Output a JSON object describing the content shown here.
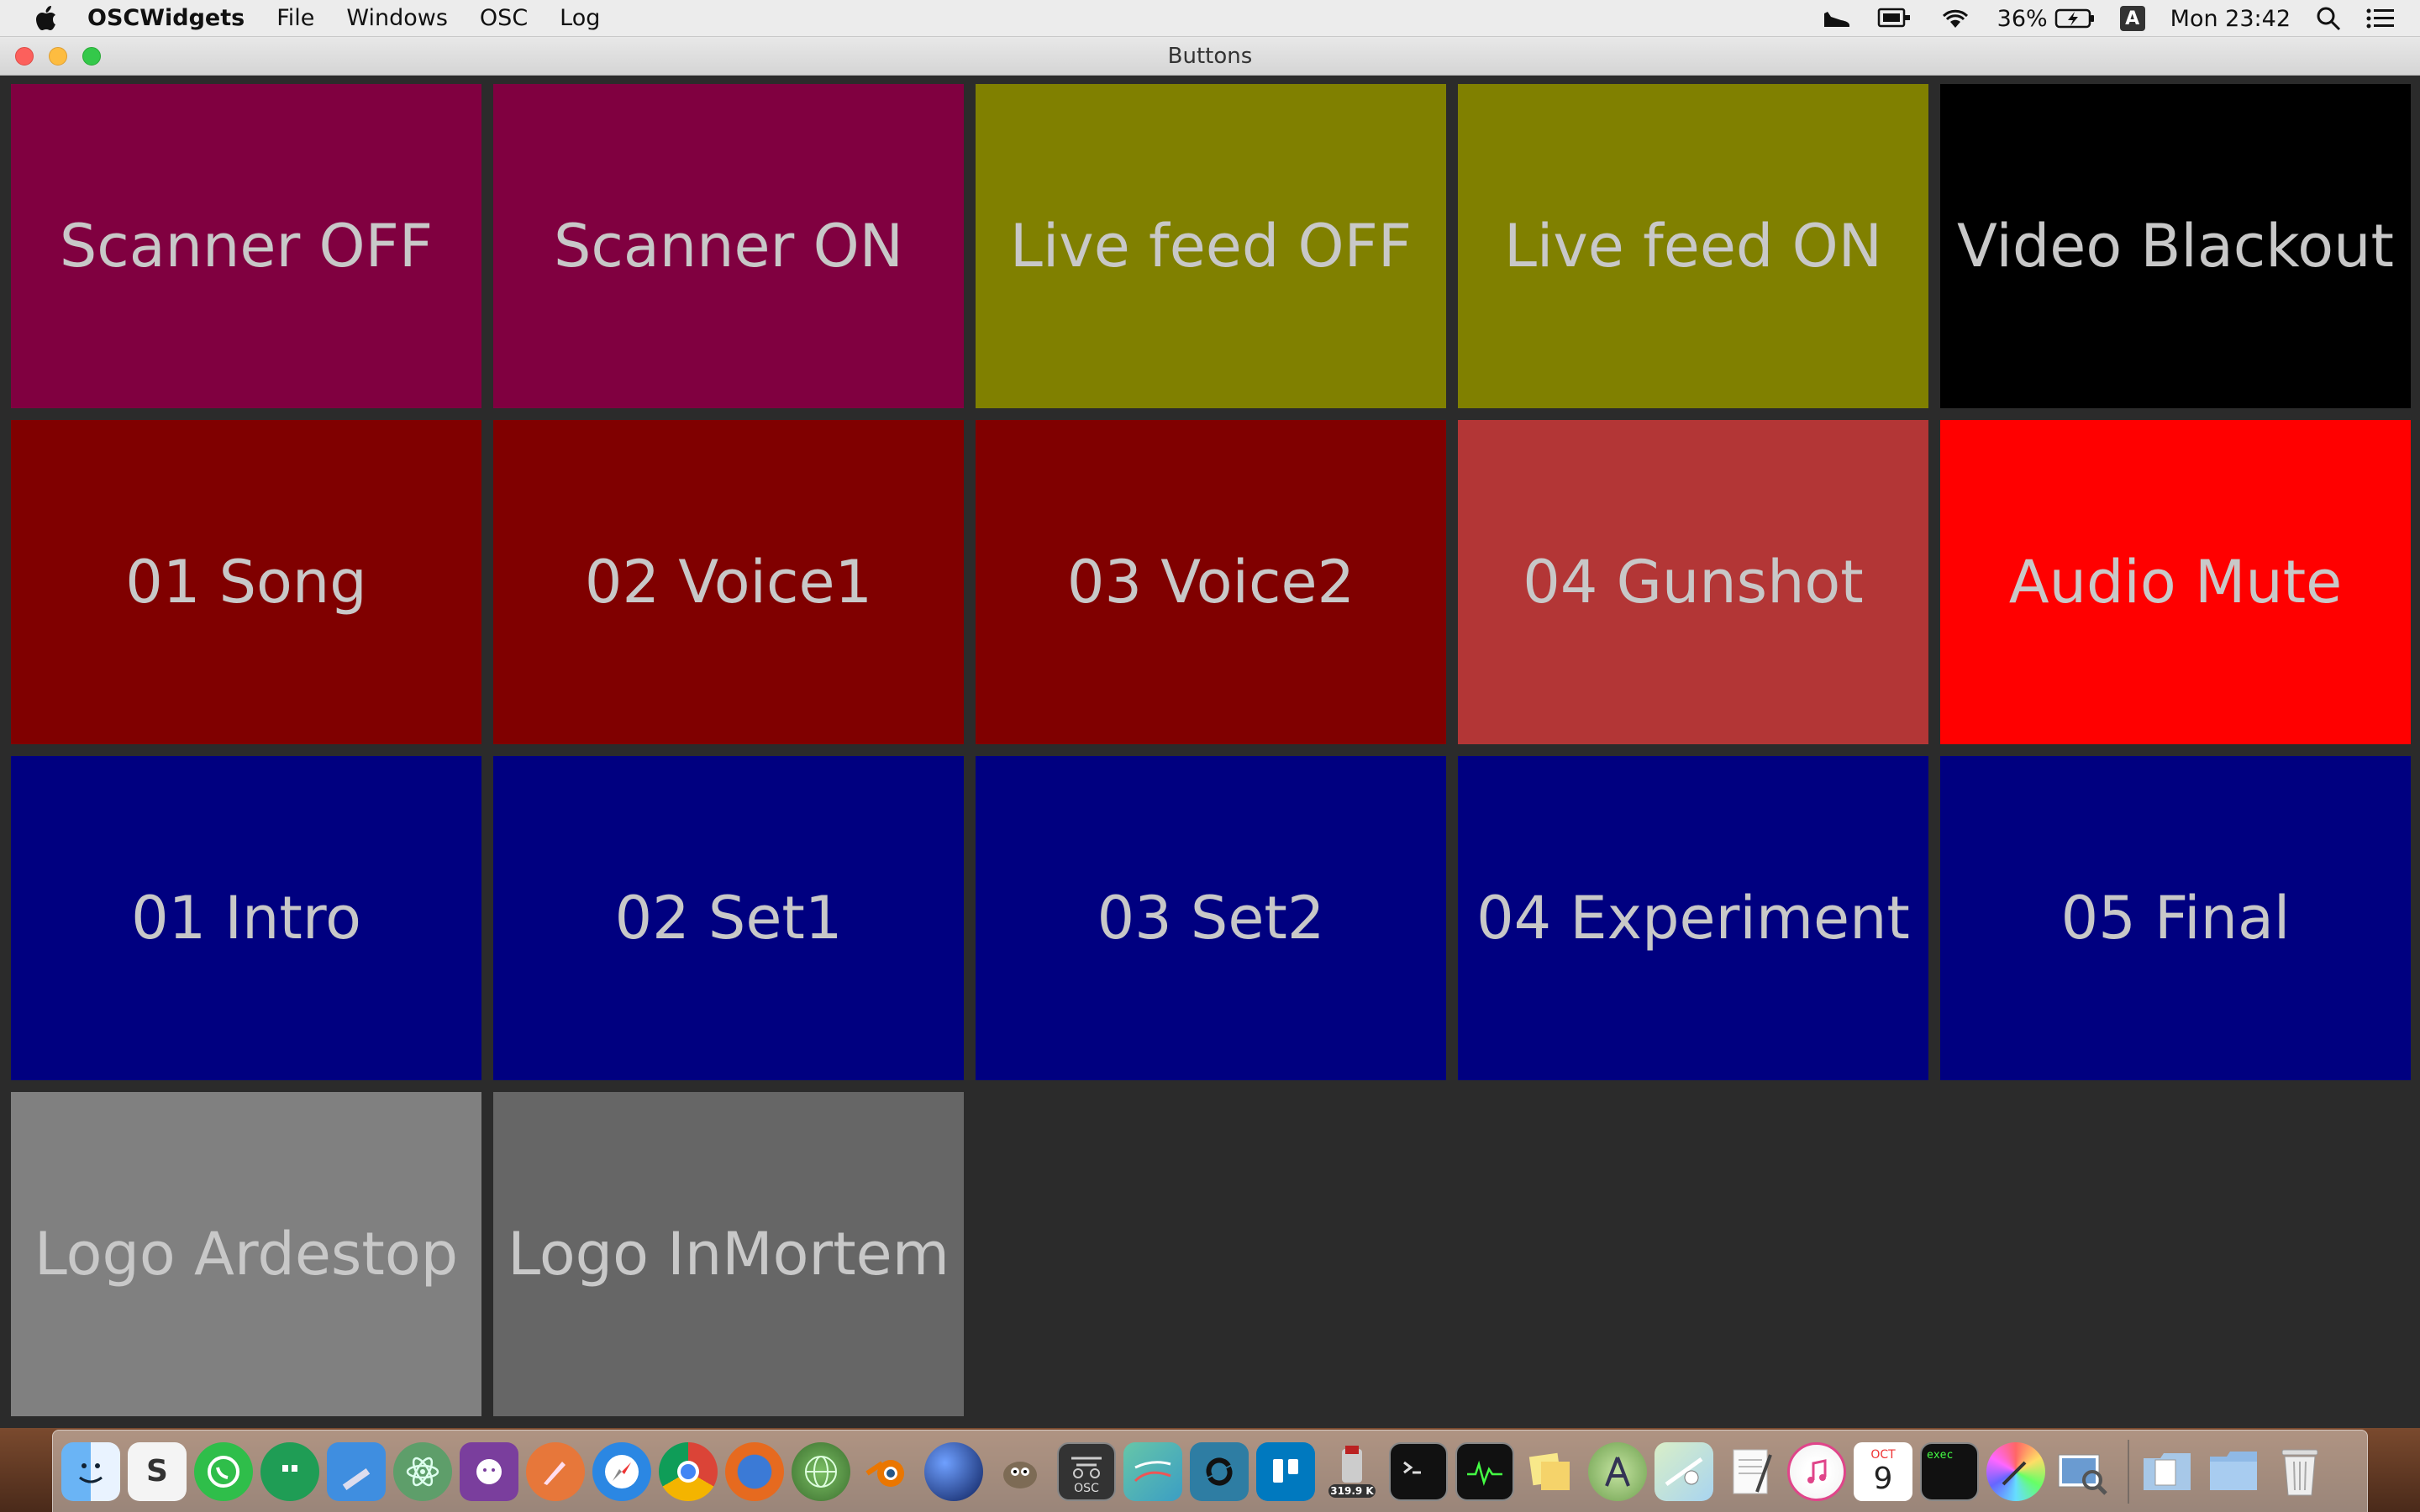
{
  "menubar": {
    "app_name": "OSCWidgets",
    "menus": [
      "File",
      "Windows",
      "OSC",
      "Log"
    ],
    "battery_percent": "36%",
    "input_source": "A",
    "clock": "Mon 23:42"
  },
  "window": {
    "title": "Buttons"
  },
  "buttons": [
    {
      "label": "Scanner OFF",
      "color": "#800040"
    },
    {
      "label": "Scanner ON",
      "color": "#800040"
    },
    {
      "label": "Live feed OFF",
      "color": "#808000"
    },
    {
      "label": "Live feed ON",
      "color": "#808000"
    },
    {
      "label": "Video Blackout",
      "color": "#000000"
    },
    {
      "label": "01 Song",
      "color": "#800000"
    },
    {
      "label": "02 Voice1",
      "color": "#800000"
    },
    {
      "label": "03 Voice2",
      "color": "#800000"
    },
    {
      "label": "04 Gunshot",
      "color": "#b33636"
    },
    {
      "label": "Audio Mute",
      "color": "#ff0000"
    },
    {
      "label": "01 Intro",
      "color": "#000080"
    },
    {
      "label": "02 Set1",
      "color": "#000080"
    },
    {
      "label": "03 Set2",
      "color": "#000080"
    },
    {
      "label": "04 Experiment",
      "color": "#000080"
    },
    {
      "label": "05 Final",
      "color": "#000080"
    },
    {
      "label": "Logo Ardestop",
      "color": "#808080"
    },
    {
      "label": "Logo InMortem",
      "color": "#666666"
    }
  ],
  "dock": {
    "badge_text": "319.9 K",
    "osc_icon_text": "OSC",
    "calendar_month": "OCT",
    "calendar_day": "9",
    "exec_text": "exec"
  }
}
